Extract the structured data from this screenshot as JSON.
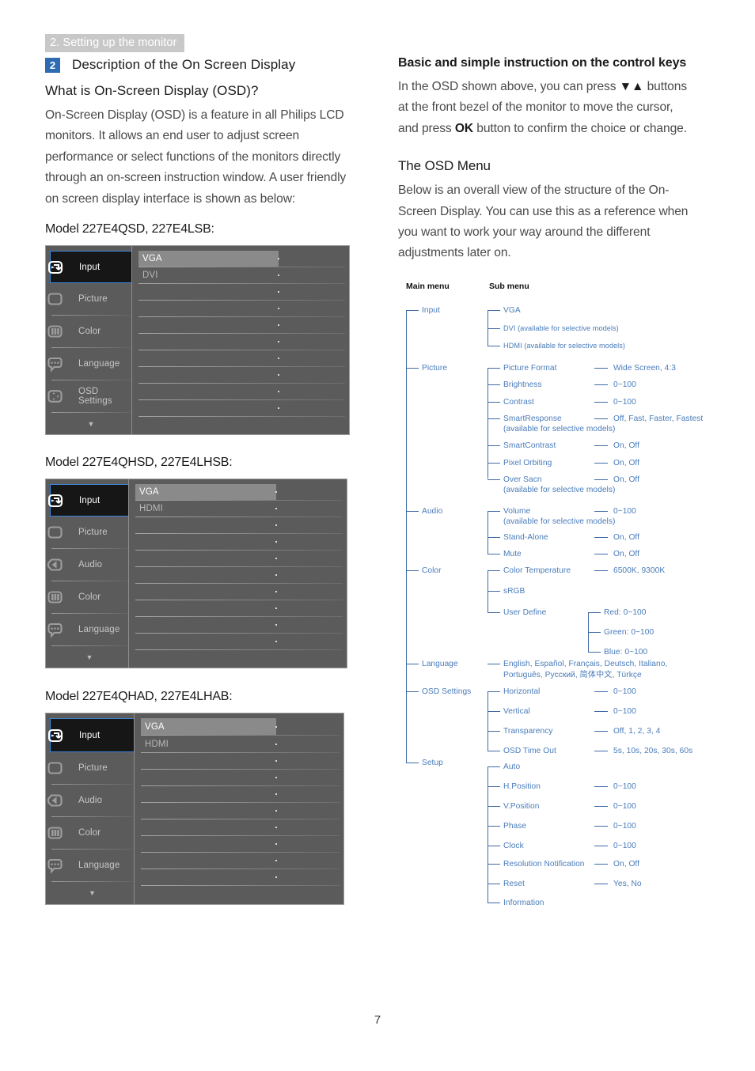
{
  "running_head": "2. Setting up the monitor",
  "page_number": "7",
  "left": {
    "section_number": "2",
    "section_title": "Description of the On Screen Display",
    "what_is_heading": "What is On-Screen Display (OSD)?",
    "what_is_body": "On-Screen Display (OSD) is a feature in all Philips LCD monitors. It allows an end user to adjust screen performance or select functions of the monitors directly through an on-screen instruction window. A user friendly on screen display interface is shown as below:",
    "model1_label": "Model 227E4QSD, 227E4LSB:",
    "model2_label": "Model 227E4QHSD, 227E4LHSB:",
    "model3_label": "Model 227E4QHAD, 227E4LHAB:"
  },
  "right": {
    "keys_heading": "Basic and simple instruction on the control keys",
    "keys_body_1": "In the OSD shown above, you can press ",
    "keys_body_down": "▼",
    "keys_body_up": "▲",
    "keys_body_2": " buttons at the front bezel of the monitor to move the cursor, and press ",
    "keys_body_ok": "OK",
    "keys_body_3": " button to confirm the choice or change.",
    "osd_menu_heading": "The OSD Menu",
    "osd_menu_body": "Below is an overall view of the structure of the On-Screen Display. You can use this as a reference when you want to work your way around the different adjustments later on."
  },
  "osd_panels": [
    {
      "id": "osd-panel-1",
      "nav": [
        {
          "label": "Input",
          "icon": "input-icon",
          "selected": true
        },
        {
          "label": "Picture",
          "icon": "picture-icon",
          "selected": false
        },
        {
          "label": "Color",
          "icon": "color-icon",
          "selected": false
        },
        {
          "label": "Language",
          "icon": "language-icon",
          "selected": false
        },
        {
          "label": "OSD Settings",
          "icon": "osd-settings-icon",
          "selected": false
        }
      ],
      "scroll_arrow": "▼",
      "rows": [
        "VGA",
        "DVI",
        "",
        "",
        "",
        "",
        "",
        "",
        "",
        "",
        ""
      ],
      "highlight_row": 0
    },
    {
      "id": "osd-panel-2",
      "nav": [
        {
          "label": "Input",
          "icon": "input-icon",
          "selected": true
        },
        {
          "label": "Picture",
          "icon": "picture-icon",
          "selected": false
        },
        {
          "label": "Audio",
          "icon": "audio-icon",
          "selected": false
        },
        {
          "label": "Color",
          "icon": "color-icon",
          "selected": false
        },
        {
          "label": "Language",
          "icon": "language-icon",
          "selected": false
        }
      ],
      "scroll_arrow": "▼",
      "rows": [
        "VGA",
        "HDMI",
        "",
        "",
        "",
        "",
        "",
        "",
        "",
        "",
        ""
      ],
      "highlight_row": 0
    },
    {
      "id": "osd-panel-3",
      "nav": [
        {
          "label": "Input",
          "icon": "input-icon",
          "selected": true
        },
        {
          "label": "Picture",
          "icon": "picture-icon",
          "selected": false
        },
        {
          "label": "Audio",
          "icon": "audio-icon",
          "selected": false
        },
        {
          "label": "Color",
          "icon": "color-icon",
          "selected": false
        },
        {
          "label": "Language",
          "icon": "language-icon",
          "selected": false
        }
      ],
      "scroll_arrow": "▼",
      "rows": [
        "VGA",
        "HDMI",
        "",
        "",
        "",
        "",
        "",
        "",
        "",
        "",
        ""
      ],
      "highlight_row": 0
    }
  ],
  "tree": {
    "header_main": "Main menu",
    "header_sub": "Sub menu",
    "main_nodes": [
      "Input",
      "Picture",
      "Audio",
      "Color",
      "Language",
      "OSD Settings",
      "Setup"
    ],
    "sub_nodes": [
      "VGA",
      "DVI (available for selective models)",
      "HDMI (available for selective models)",
      "Picture Format",
      "Brightness",
      "Contrast",
      "SmartResponse\n(available for selective models)",
      "SmartContrast",
      "Pixel Orbiting",
      "Over Sacn\n(available for selective models)",
      "Volume\n(available for selective models)",
      "Stand-Alone",
      "Mute",
      "Color Temperature",
      "sRGB",
      "User Define",
      "English, Español, Français, Deutsch, Italiano,\nPortuguês, Русский, 简体中文, Türkçe",
      "Horizontal",
      "Vertical",
      "Transparency",
      "OSD Time Out",
      "Auto",
      "H.Position",
      "V.Position",
      "Phase",
      "Clock",
      "Resolution Notification",
      "Reset",
      "Information"
    ],
    "value_nodes": [
      "Wide Screen, 4:3",
      "0~100",
      "0~100",
      "Off, Fast, Faster, Fastest",
      "On, Off",
      "On, Off",
      "On, Off",
      "0~100",
      "On, Off",
      "On, Off",
      "6500K, 9300K",
      "Red: 0~100",
      "Green: 0~100",
      "Blue: 0~100",
      "0~100",
      "0~100",
      "Off, 1, 2, 3, 4",
      "5s, 10s, 20s, 30s, 60s",
      "0~100",
      "0~100",
      "0~100",
      "0~100",
      "On, Off",
      "Yes, No"
    ]
  },
  "colors": {
    "accent_blue": "#2e6bb0",
    "tree_blue": "#4a7cba",
    "runhead_gray": "#c8c8c8",
    "osd_bg": "#5b5b5b",
    "osd_selected": "#161616",
    "osd_focus_border": "#3c86d8"
  }
}
